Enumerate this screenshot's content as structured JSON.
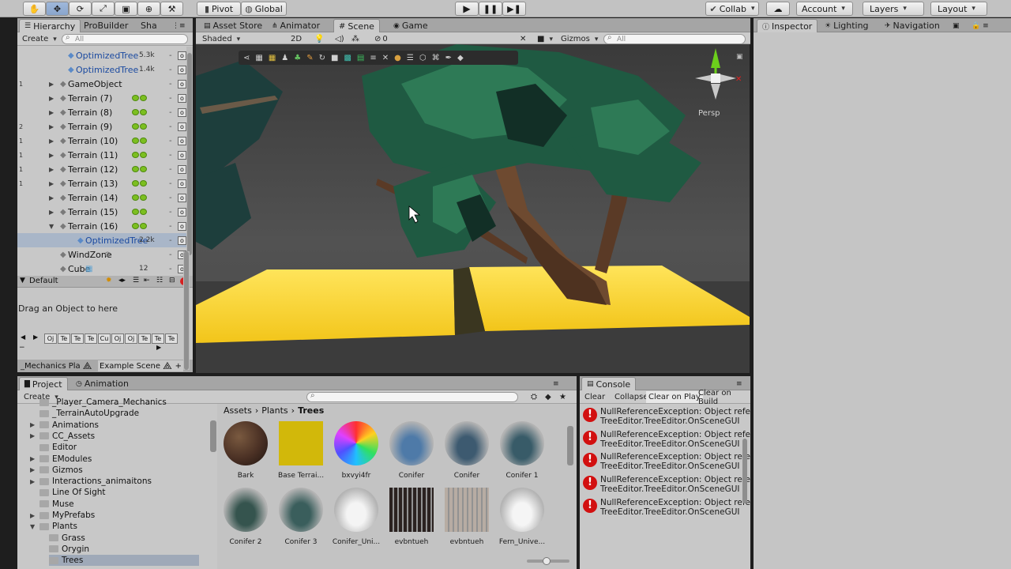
{
  "toolbar": {
    "pivot": "Pivot",
    "global": "Global",
    "collab": "Collab",
    "account": "Account",
    "layers": "Layers",
    "layout": "Layout"
  },
  "hierarchy": {
    "tabs": [
      "Hierarchy",
      "ProBuilder",
      "Sha"
    ],
    "create": "Create",
    "search_placeholder": "All",
    "rows": [
      {
        "num": "",
        "name": "OptimizedTree",
        "size": "5.3k"
      },
      {
        "num": "",
        "name": "OptimizedTree",
        "size": "1.4k"
      },
      {
        "num": "1",
        "name": "GameObject",
        "size": ""
      },
      {
        "num": "",
        "name": "Terrain (7)",
        "size": ""
      },
      {
        "num": "",
        "name": "Terrain (8)",
        "size": ""
      },
      {
        "num": "2",
        "name": "Terrain (9)",
        "size": ""
      },
      {
        "num": "1",
        "name": "Terrain (10)",
        "size": ""
      },
      {
        "num": "1",
        "name": "Terrain (11)",
        "size": ""
      },
      {
        "num": "1",
        "name": "Terrain (12)",
        "size": ""
      },
      {
        "num": "1",
        "name": "Terrain (13)",
        "size": ""
      },
      {
        "num": "",
        "name": "Terrain (14)",
        "size": ""
      },
      {
        "num": "",
        "name": "Terrain (15)",
        "size": ""
      },
      {
        "num": "",
        "name": "Terrain (16)",
        "size": ""
      },
      {
        "num": "",
        "name": "OptimizedTree",
        "size": "2.2k"
      },
      {
        "num": "",
        "name": "WindZone",
        "size": ""
      },
      {
        "num": "",
        "name": "Cube",
        "size": "12"
      }
    ],
    "default_label": "Default",
    "drag_text": "Drag an Object to here",
    "chip_labels": [
      "Oj",
      "Te",
      "Te",
      "Te",
      "Cu",
      "Oj",
      "Oj",
      "Te",
      "Te",
      "Te"
    ],
    "scene_tab_1": "_Mechanics Pla",
    "scene_tab_2": "Example Scene"
  },
  "scene": {
    "tabs": [
      "Asset Store",
      "Animator",
      "Scene",
      "Game"
    ],
    "shaded": "Shaded",
    "mode_2d": "2D",
    "gizmos": "Gizmos",
    "search_placeholder": "All",
    "counter": "0",
    "persp": "Persp"
  },
  "inspector": {
    "tabs": [
      "Inspector",
      "Lighting",
      "Navigation"
    ]
  },
  "project": {
    "tabs": [
      "Project",
      "Animation"
    ],
    "create": "Create",
    "breadcrumb": [
      "Assets",
      "Plants",
      "Trees"
    ],
    "folders": [
      {
        "name": "_Player_Camera_Mechanics",
        "indent": 1,
        "arrow": ""
      },
      {
        "name": "_TerrainAutoUpgrade",
        "indent": 1,
        "arrow": ""
      },
      {
        "name": "Animations",
        "indent": 1,
        "arrow": "right"
      },
      {
        "name": "CC_Assets",
        "indent": 1,
        "arrow": "right"
      },
      {
        "name": "Editor",
        "indent": 1,
        "arrow": ""
      },
      {
        "name": "EModules",
        "indent": 1,
        "arrow": "right"
      },
      {
        "name": "Gizmos",
        "indent": 1,
        "arrow": "right"
      },
      {
        "name": "Interactions_animaitons",
        "indent": 1,
        "arrow": "right"
      },
      {
        "name": "Line Of Sight",
        "indent": 1,
        "arrow": ""
      },
      {
        "name": "Muse",
        "indent": 1,
        "arrow": ""
      },
      {
        "name": "MyPrefabs",
        "indent": 1,
        "arrow": "right"
      },
      {
        "name": "Plants",
        "indent": 1,
        "arrow": "down"
      },
      {
        "name": "Grass",
        "indent": 2,
        "arrow": ""
      },
      {
        "name": "Orygin",
        "indent": 2,
        "arrow": ""
      },
      {
        "name": "Trees",
        "indent": 2,
        "arrow": ""
      }
    ],
    "assets": [
      {
        "name": "Bark",
        "color": "#4a3024"
      },
      {
        "name": "Base Terrai...",
        "color": "#d2b80a"
      },
      {
        "name": "bxvyi4fr",
        "color": "rainbow"
      },
      {
        "name": "Conifer",
        "color": "#4e7aa8"
      },
      {
        "name": "Conifer",
        "color": "#3d5a70"
      },
      {
        "name": "Conifer 1",
        "color": "#385b68"
      },
      {
        "name": "Conifer 2",
        "color": "#35544e"
      },
      {
        "name": "Conifer 3",
        "color": "#3a5e5c"
      },
      {
        "name": "Conifer_Uni...",
        "color": "#f4f4f4"
      },
      {
        "name": "evbntueh",
        "color": "#2b2220"
      },
      {
        "name": "evbntueh",
        "color": "#b7aca3"
      },
      {
        "name": "Fern_Unive...",
        "color": "#f5f5f5"
      }
    ]
  },
  "console": {
    "tab": "Console",
    "buttons": [
      "Clear",
      "Collapse",
      "Clear on Play",
      "Clear on Build"
    ],
    "messages": [
      {
        "line1": "NullReferenceException: Object refe",
        "line2": "TreeEditor.TreeEditor.OnSceneGUI"
      },
      {
        "line1": "NullReferenceException: Object refe",
        "line2": "TreeEditor.TreeEditor.OnSceneGUI"
      },
      {
        "line1": "NullReferenceException: Object refe",
        "line2": "TreeEditor.TreeEditor.OnSceneGUI"
      },
      {
        "line1": "NullReferenceException: Object refe",
        "line2": "TreeEditor.TreeEditor.OnSceneGUI"
      },
      {
        "line1": "NullReferenceException: Object refe",
        "line2": "TreeEditor.TreeEditor.OnSceneGUI"
      }
    ]
  }
}
